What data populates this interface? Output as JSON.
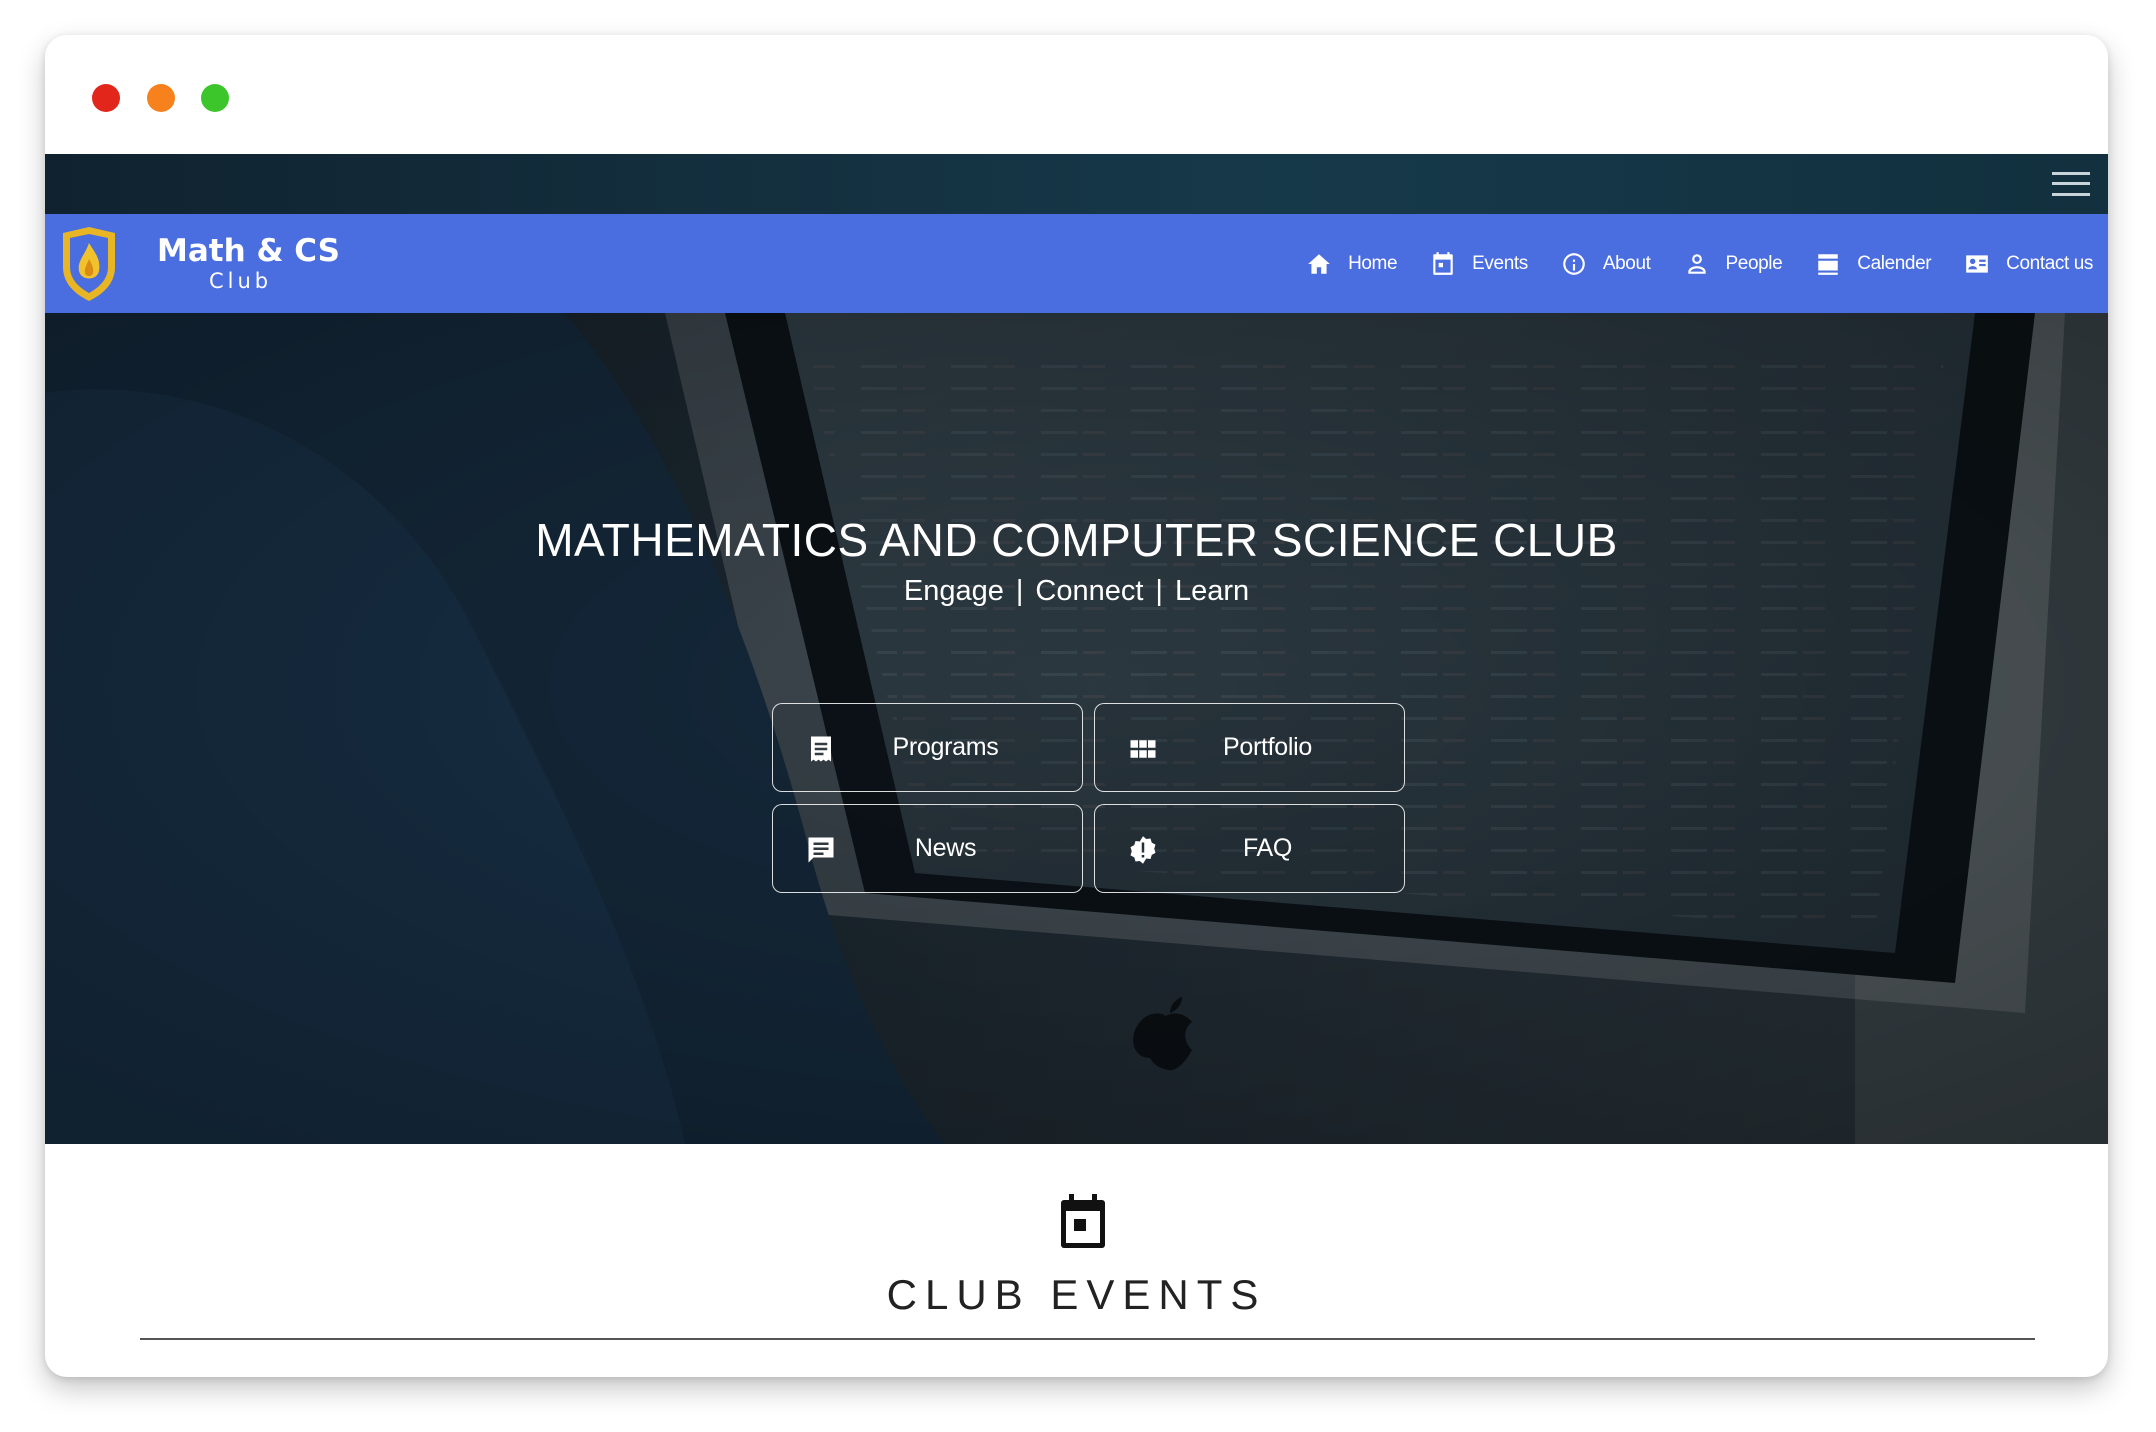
{
  "window": {
    "controls": [
      "close",
      "minimize",
      "maximize"
    ]
  },
  "brand": {
    "title": "Math & CS",
    "subtitle": "Club",
    "logo_icon": "shield-flame-logo"
  },
  "nav": {
    "menu_icon": "hamburger-icon",
    "items": [
      {
        "label": "Home",
        "icon": "home-icon"
      },
      {
        "label": "Events",
        "icon": "calendar-icon"
      },
      {
        "label": "About",
        "icon": "info-icon"
      },
      {
        "label": "People",
        "icon": "person-icon"
      },
      {
        "label": "Calender",
        "icon": "calendar-view-icon"
      },
      {
        "label": "Contact us",
        "icon": "contact-card-icon"
      }
    ]
  },
  "hero": {
    "title": "MATHEMATICS AND COMPUTER SCIENCE CLUB",
    "tagline": [
      "Engage",
      "Connect",
      "Learn"
    ],
    "separator": "|",
    "buttons": [
      {
        "label": "Programs",
        "icon": "document-list-icon"
      },
      {
        "label": "Portfolio",
        "icon": "grid-icon"
      },
      {
        "label": "News",
        "icon": "chat-bubble-icon"
      },
      {
        "label": "FAQ",
        "icon": "alert-badge-icon"
      }
    ]
  },
  "events": {
    "title": "CLUB EVENTS",
    "icon": "calendar-icon"
  },
  "colors": {
    "navbar": "#4a6ddf",
    "topstrip": "#14323f",
    "accent_gold": "#e8b624"
  }
}
